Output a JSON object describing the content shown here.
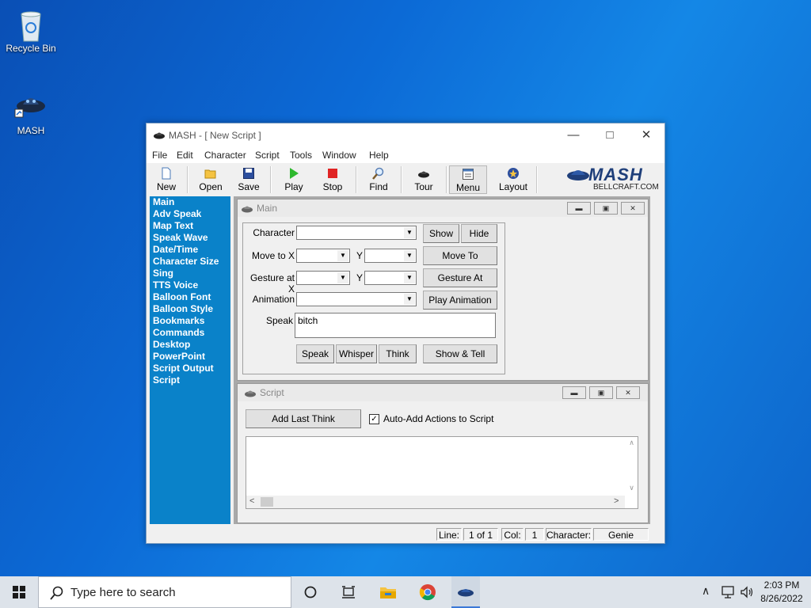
{
  "desktop": {
    "icons": [
      {
        "label": "Recycle Bin",
        "icon": "recycle-bin-icon"
      },
      {
        "label": "MASH",
        "icon": "mash-app-icon"
      }
    ]
  },
  "window": {
    "title": "MASH - [ New Script ]",
    "menu": [
      "File",
      "Edit",
      "Character",
      "Script",
      "Tools",
      "Window",
      "Help"
    ],
    "toolbar": [
      {
        "label": "New",
        "icon": "new-file-icon"
      },
      {
        "label": "Open",
        "icon": "open-folder-icon"
      },
      {
        "label": "Save",
        "icon": "save-disk-icon"
      },
      {
        "label": "Play",
        "icon": "play-icon"
      },
      {
        "label": "Stop",
        "icon": "stop-icon"
      },
      {
        "label": "Find",
        "icon": "find-icon"
      },
      {
        "label": "Tour",
        "icon": "tour-icon"
      },
      {
        "label": "Menu",
        "icon": "menu-icon"
      },
      {
        "label": "Layout",
        "icon": "layout-icon"
      }
    ],
    "brand": {
      "logo_text": "MASH",
      "site": "BELLCRAFT.COM"
    }
  },
  "sidebar": {
    "items": [
      "Main",
      "Adv Speak",
      "Map Text",
      "Speak Wave",
      "Date/Time",
      "Character Size",
      "Sing",
      "TTS Voice",
      "Balloon Font",
      "Balloon Style",
      "Bookmarks",
      "Commands",
      "Desktop",
      "PowerPoint",
      "Script Output",
      "Script"
    ]
  },
  "main_panel": {
    "title": "Main",
    "labels": {
      "character": "Character",
      "move_to_x": "Move to X",
      "y1": "Y",
      "gesture_at_x": "Gesture at X",
      "y2": "Y",
      "animation": "Animation",
      "speak": "Speak"
    },
    "buttons": {
      "show": "Show",
      "hide": "Hide",
      "move_to": "Move To",
      "gesture_at": "Gesture At",
      "play_animation": "Play Animation",
      "speak": "Speak",
      "whisper": "Whisper",
      "think": "Think",
      "show_tell": "Show & Tell"
    },
    "speak_text": "bitch"
  },
  "script_panel": {
    "title": "Script",
    "add_last_think": "Add Last Think",
    "auto_add_label": "Auto-Add Actions to Script",
    "auto_add_checked": true
  },
  "statusbar": {
    "line_label": "Line:",
    "line_value": "1 of 1",
    "col_label": "Col:",
    "col_value": "1",
    "character_label": "Character:",
    "character_value": "Genie"
  },
  "taskbar": {
    "search_placeholder": "Type here to search",
    "time": "2:03 PM",
    "date": "8/26/2022"
  }
}
